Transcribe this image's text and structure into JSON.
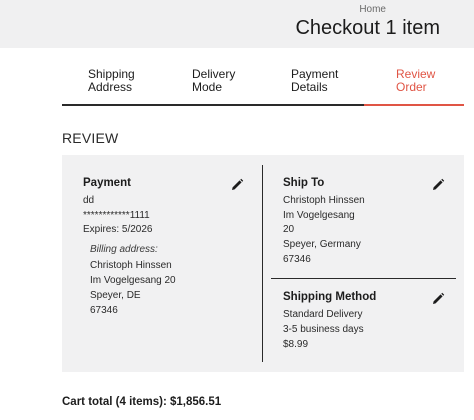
{
  "header": {
    "breadcrumb": "Home",
    "title": "Checkout 1 item"
  },
  "steps": [
    {
      "line1": "Shipping",
      "line2": "Address",
      "active": false
    },
    {
      "line1": "Delivery",
      "line2": "Mode",
      "active": false
    },
    {
      "line1": "Payment",
      "line2": "Details",
      "active": false
    },
    {
      "line1": "Review",
      "line2": "Order",
      "active": true
    }
  ],
  "colors": {
    "accent": "#e05545",
    "panel_bg": "#f1f1f2",
    "header_bg": "#f0f0f1"
  },
  "review": {
    "title": "REVIEW",
    "payment": {
      "title": "Payment",
      "name": "dd",
      "card": "************1111",
      "expires": "Expires: 5/2026",
      "billing_label": "Billing address:",
      "billing": [
        "Christoph Hinssen",
        "Im Vogelgesang 20",
        "Speyer, DE",
        "67346"
      ],
      "edit_icon": "pencil-icon"
    },
    "ship_to": {
      "title": "Ship To",
      "lines": [
        "Christoph Hinssen",
        "Im Vogelgesang",
        "20",
        "Speyer, Germany",
        "67346"
      ],
      "edit_icon": "pencil-icon"
    },
    "shipping_method": {
      "title": "Shipping Method",
      "lines": [
        "Standard Delivery",
        "3-5 business days",
        "$8.99"
      ],
      "edit_icon": "pencil-icon"
    }
  },
  "cart_total": "Cart total (4 items): $1,856.51"
}
